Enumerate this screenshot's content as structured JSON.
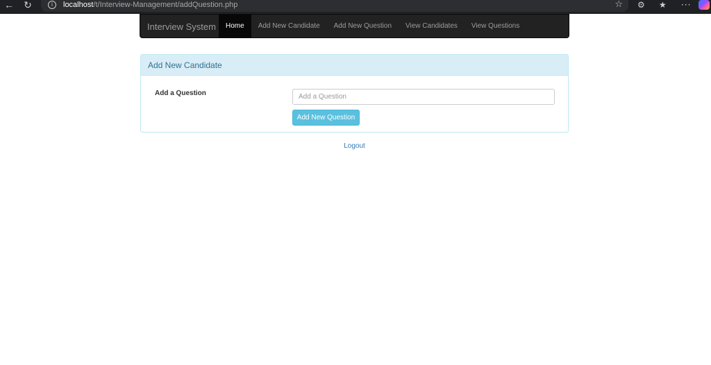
{
  "browser": {
    "url_host": "localhost",
    "url_path": "/t/Interview-Management/addQuestion.php",
    "back_icon": "arrow-left-icon",
    "reload_icon": "reload-icon",
    "info_icon": "info-icon",
    "star_icon": "star-icon",
    "extensions_icon": "extensions-icon",
    "favorites_icon": "favorites-icon",
    "more_icon": "more-icon",
    "copilot_icon": "copilot-icon"
  },
  "navbar": {
    "brand": "Interview System",
    "items": [
      {
        "label": "Home",
        "active": true
      },
      {
        "label": "Add New Candidate",
        "active": false
      },
      {
        "label": "Add New Question",
        "active": false
      },
      {
        "label": "View Candidates",
        "active": false
      },
      {
        "label": "View Questions",
        "active": false
      }
    ]
  },
  "panel": {
    "heading": "Add New Candidate",
    "form": {
      "label": "Add a Question",
      "input_value": "",
      "input_placeholder": "Add a Question",
      "submit_label": "Add New Question"
    }
  },
  "logout_label": "Logout",
  "colors": {
    "navbar_bg": "#222222",
    "panel_heading_bg": "#d9edf7",
    "panel_heading_text": "#31708f",
    "button_info": "#5bc0de",
    "link": "#337ab7"
  }
}
